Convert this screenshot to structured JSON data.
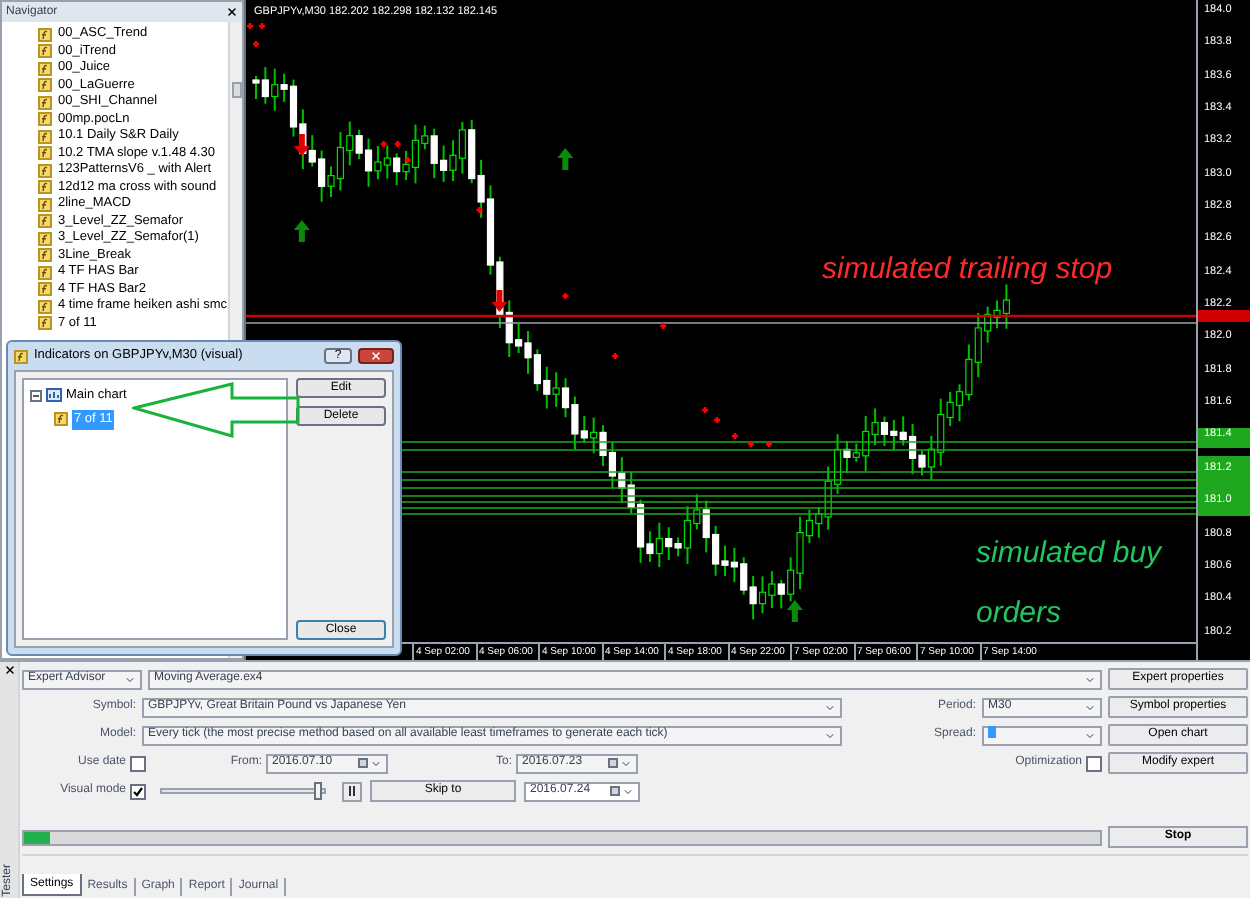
{
  "navigator": {
    "title": "Navigator",
    "items": [
      {
        "label": "00_ASC_Trend"
      },
      {
        "label": "00_iTrend"
      },
      {
        "label": "00_Juice"
      },
      {
        "label": "00_LaGuerre"
      },
      {
        "label": "00_SHI_Channel"
      },
      {
        "label": "00mp.pocLn"
      },
      {
        "label": "10.1 Daily S&R Daily"
      },
      {
        "label": "10.2 TMA slope v.1.48 4.30"
      },
      {
        "label": "123PatternsV6 _ with Alert"
      },
      {
        "label": "12d12 ma cross with sound"
      },
      {
        "label": "2line_MACD"
      },
      {
        "label": "3_Level_ZZ_Semafor"
      },
      {
        "label": "3_Level_ZZ_Semafor(1)"
      },
      {
        "label": "3Line_Break"
      },
      {
        "label": "4 TF HAS Bar"
      },
      {
        "label": "4 TF HAS Bar2"
      },
      {
        "label": "4 time frame heiken ashi smc"
      },
      {
        "label": "7 of 11"
      }
    ]
  },
  "chart": {
    "title": "GBPJPYv,M30 182.202 182.298 182.132 182.145",
    "price_labels": [
      "184.0",
      "183.8",
      "183.6",
      "183.4",
      "183.2",
      "183.0",
      "182.8",
      "182.6",
      "182.4",
      "182.2",
      "182.0",
      "181.8",
      "181.6",
      "181.4",
      "181.2",
      "181.0",
      "180.8",
      "180.6",
      "180.4",
      "180.2"
    ],
    "time_labels": [
      "4 Sep 02:00",
      "4 Sep 06:00",
      "4 Sep 10:00",
      "4 Sep 14:00",
      "4 Sep 18:00",
      "4 Sep 22:00",
      "7 Sep 02:00",
      "7 Sep 06:00",
      "7 Sep 10:00",
      "7 Sep 14:00"
    ],
    "annotations": [
      {
        "text": "simulated trailing stop",
        "color": "#ff2a2a"
      },
      {
        "text": "simulated buy orders",
        "color": "#22c55e"
      }
    ]
  },
  "dialog": {
    "title": "Indicators on GBPJPYv,M30 (visual)",
    "help_button": "?",
    "tree": [
      {
        "label": "Main chart",
        "expanded": true,
        "children": [
          {
            "label": "7 of 11",
            "selected": true
          }
        ]
      }
    ],
    "buttons": [
      "Edit",
      "Delete"
    ],
    "close_button": "Close"
  },
  "tester": {
    "panel_label": "Tester",
    "expert_type": "Expert Advisor",
    "expert": "Moving Average.ex4",
    "symbol_label": "Symbol:",
    "symbol": "GBPJPYv, Great Britain Pound vs Japanese Yen",
    "period_label": "Period:",
    "period": "M30",
    "model_label": "Model:",
    "model": "Every tick (the most precise method based on all available least timeframes to generate each tick)",
    "spread_label": "Spread:",
    "use_date": {
      "label": "Use date",
      "checked": false
    },
    "from_label": "From:",
    "from": "2016.07.10",
    "to_label": "To:",
    "to": "2016.07.23",
    "optimization": {
      "label": "Optimization",
      "checked": false
    },
    "visual_mode": {
      "label": "Visual mode",
      "checked": true
    },
    "speed": {
      "level": 0.97
    },
    "skip_button": "Skip to",
    "skip_date": "2016.07.24",
    "side_buttons": [
      "Expert properties",
      "Symbol properties",
      "Open chart",
      "Modify expert"
    ],
    "progress": {
      "level": 0.025
    },
    "stop_button": "Stop",
    "tabs": [
      {
        "label": "Settings",
        "selected": true
      },
      {
        "label": "Results",
        "selected": false
      },
      {
        "label": "Graph",
        "selected": false
      },
      {
        "label": "Report",
        "selected": false
      },
      {
        "label": "Journal",
        "selected": false
      }
    ]
  }
}
